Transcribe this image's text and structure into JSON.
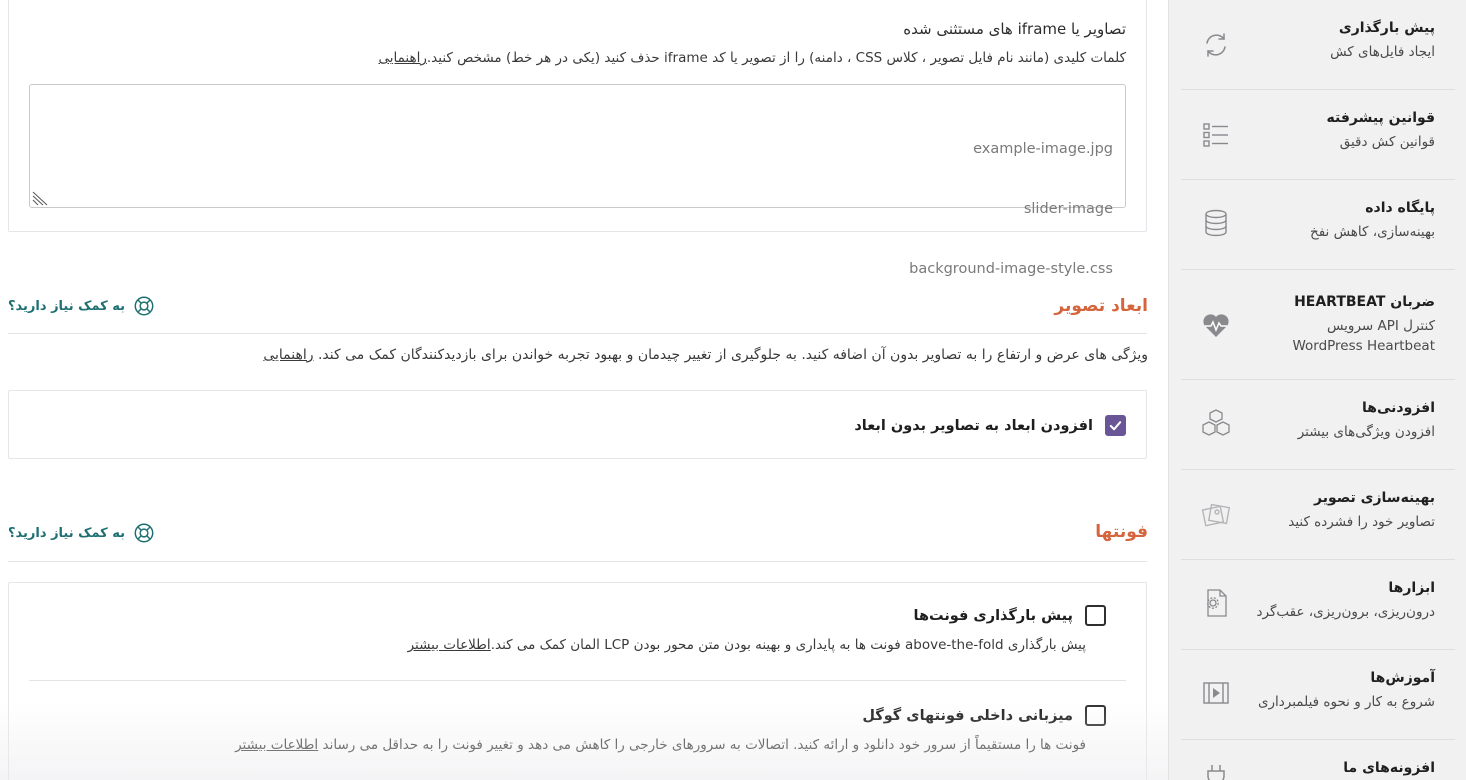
{
  "exclusions": {
    "title": "تصاویر یا iframe های مستثنی شده",
    "description": "کلمات کلیدی (مانند نام فایل تصویر ، کلاس CSS ، دامنه) را از تصویر یا کد iframe حذف کنید (یکی در هر خط) مشخص کنید.",
    "guide_link": "راهنمایی",
    "placeholder_lines": [
      "example-image.jpg",
      "slider-image",
      "background-image-style.css"
    ]
  },
  "help_label": "به کمک نیاز دارید؟",
  "image_dimensions": {
    "title": "ابعاد تصویر",
    "description": "ویژگی های عرض و ارتفاع را به تصاویر بدون آن اضافه کنید. به جلوگیری از تغییر چیدمان و بهبود تجربه خواندن برای بازدیدکنندگان کمک می کند.",
    "guide_link": "راهنمایی",
    "option_label": "افزودن ابعاد به تصاویر بدون ابعاد",
    "checked": true
  },
  "fonts": {
    "title": "فونتها",
    "options": [
      {
        "label": "پیش بارگذاری فونت‌ها",
        "description": "پیش بارگذاری above-the-fold فونت ها به پایداری و بهینه بودن متن محور بودن LCP المان کمک می کند.",
        "link": "اطلاعات بیشتر",
        "checked": false
      },
      {
        "label": "میزبانی داخلی فونتهای گوگل",
        "description": "فونت ها را مستقیماً از سرور خود دانلود و ارائه کنید. اتصالات به سرورهای خارجی را کاهش می دهد و تغییر فونت را به حداقل می رساند",
        "link": "اطلاعات بیشتر",
        "checked": false
      }
    ]
  },
  "sidebar": {
    "items": [
      {
        "title": "پیش بارگذاری",
        "subtitle": "ایجاد فایل‌های کش",
        "icon": "refresh-icon"
      },
      {
        "title": "قوانین پیشرفته",
        "subtitle": "قوانین کش دقیق",
        "icon": "checklist-icon"
      },
      {
        "title": "پایگاه داده",
        "subtitle": "بهینه‌سازی، کاهش نفخ",
        "icon": "database-icon"
      },
      {
        "title": "ضربان HEARTBEAT",
        "subtitle": "کنترل API سرویس\nWordPress Heartbeat",
        "icon": "heartbeat-icon"
      },
      {
        "title": "افزودنی‌ها",
        "subtitle": "افزودن ویژگی‌های بیشتر",
        "icon": "cubes-icon"
      },
      {
        "title": "بهینه‌سازی تصویر",
        "subtitle": "تصاویر خود را فشرده کنید",
        "icon": "images-icon"
      },
      {
        "title": "ابزارها",
        "subtitle": "درون‌ریزی، برون‌ریزی، عقب‌گرد",
        "icon": "file-gear-icon"
      },
      {
        "title": "آموزش‌ها",
        "subtitle": "شروع به کار و نحوه فیلمبرداری",
        "icon": "video-icon"
      },
      {
        "title": "افزونه‌های ما",
        "subtitle": "",
        "icon": "plug-icon"
      }
    ]
  },
  "colors": {
    "accent": "#d4653c",
    "help": "#1d6f72",
    "checkbox": "#6a5597"
  }
}
